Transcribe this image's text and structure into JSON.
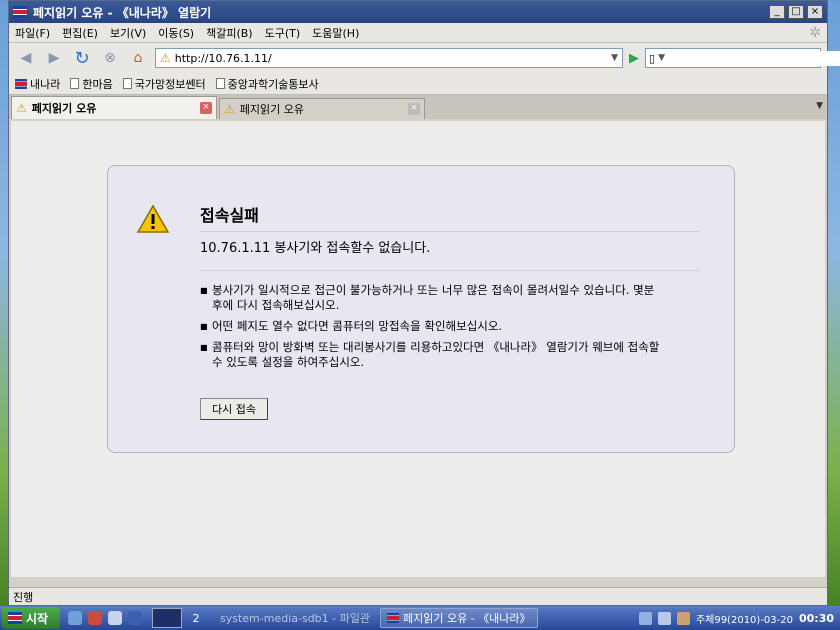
{
  "window": {
    "title": "페지읽기 오유 - 《내나라》 열람기",
    "controls": {
      "minimize": "_",
      "maximize": "□",
      "close": "×"
    }
  },
  "menu": [
    "파일(F)",
    "편집(E)",
    "보기(V)",
    "이동(S)",
    "책갈피(B)",
    "도구(T)",
    "도움말(H)"
  ],
  "nav": {
    "url": "http://10.76.1.11/",
    "back_icon": "back-arrow-icon",
    "forward_icon": "forward-arrow-icon",
    "reload_icon": "reload-icon",
    "stop_icon": "stop-icon",
    "home_icon": "home-icon"
  },
  "bookmarks": [
    {
      "label": "내나라",
      "icon": "flag-favicon"
    },
    {
      "label": "한마음",
      "icon": "page-icon"
    },
    {
      "label": "국가망정보쎈터",
      "icon": "page-icon"
    },
    {
      "label": "중앙과학기술통보사",
      "icon": "page-icon"
    }
  ],
  "tabs": [
    {
      "label": "페지읽기 오유",
      "active": true
    },
    {
      "label": "페지읽기 오유",
      "active": false
    }
  ],
  "error": {
    "title": "접속실패",
    "message": "10.76.1.11 봉사기와 접속할수 없습니다.",
    "items": [
      "봉사기가 일시적으로 접근이 불가능하거나 또는 너무 많은 접속이 몰려서일수 있습니다. 몇분후에 다시 접속해보십시오.",
      "어떤 페지도 열수 없다면 콤퓨터의 망접속을 확인해보십시오.",
      "콤퓨터와 망이 방화벽 또는 대리봉사기를 리용하고있다면 《내나라》 열람기가 웨브에 접속할수 있도록 설정을 하여주십시오."
    ],
    "retry_label": "다시 접속"
  },
  "status": {
    "text": "진행"
  },
  "taskbar": {
    "start_label": "시작",
    "workspace_1": "",
    "workspace_2": "2",
    "items": [
      {
        "label": "system-media-sdb1 - 파일관",
        "active": false
      },
      {
        "label": "페지읽기 오유 - 《내나라》",
        "active": true
      }
    ],
    "date": "주체99(2010)-03-20",
    "time": "00:30"
  },
  "colors": {
    "titlebar": "#28457f",
    "error_box_bg": "#e8e6f1",
    "warning": "#d8a200",
    "taskbar": "#27479a"
  }
}
